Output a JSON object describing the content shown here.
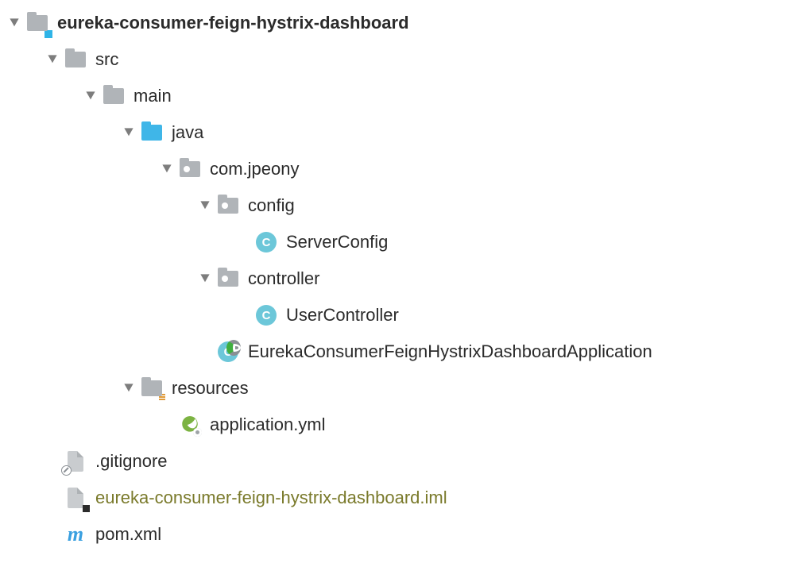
{
  "indent_unit": 48,
  "tree": [
    {
      "depth": 0,
      "expand": true,
      "icon": "module-folder",
      "label": "eureka-consumer-feign-hystrix-dashboard",
      "bold": true
    },
    {
      "depth": 1,
      "expand": true,
      "icon": "folder",
      "label": "src"
    },
    {
      "depth": 2,
      "expand": true,
      "icon": "folder",
      "label": "main"
    },
    {
      "depth": 3,
      "expand": true,
      "icon": "folder-blue",
      "label": "java"
    },
    {
      "depth": 4,
      "expand": true,
      "icon": "package",
      "label": "com.jpeony"
    },
    {
      "depth": 5,
      "expand": true,
      "icon": "package",
      "label": "config"
    },
    {
      "depth": 6,
      "expand": false,
      "icon": "class",
      "label": "ServerConfig"
    },
    {
      "depth": 5,
      "expand": true,
      "icon": "package",
      "label": "controller"
    },
    {
      "depth": 6,
      "expand": false,
      "icon": "class",
      "label": "UserController"
    },
    {
      "depth": 5,
      "expand": false,
      "icon": "class-run",
      "label": "EurekaConsumerFeignHystrixDashboardApplication"
    },
    {
      "depth": 3,
      "expand": true,
      "icon": "resources",
      "label": "resources"
    },
    {
      "depth": 4,
      "expand": false,
      "icon": "spring-yml",
      "label": "application.yml"
    },
    {
      "depth": 1,
      "expand": false,
      "icon": "file-ignore",
      "label": ".gitignore"
    },
    {
      "depth": 1,
      "expand": false,
      "icon": "file-iml",
      "label": "eureka-consumer-feign-hystrix-dashboard.iml",
      "olive": true
    },
    {
      "depth": 1,
      "expand": false,
      "icon": "maven",
      "label": "pom.xml"
    }
  ]
}
